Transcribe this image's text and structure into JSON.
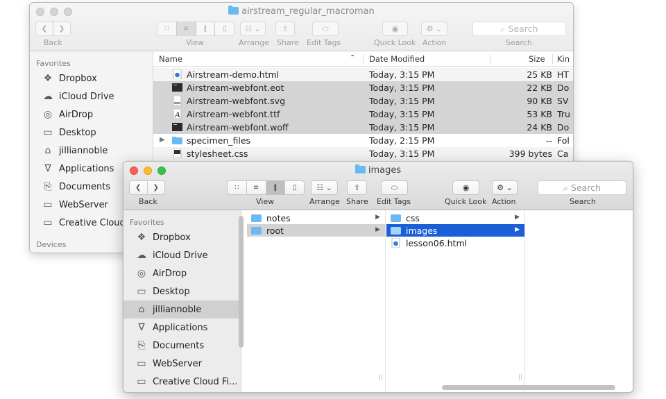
{
  "back_window": {
    "title": "airstream_regular_macroman",
    "toolbar": {
      "back_label": "Back",
      "view_label": "View",
      "arrange_label": "Arrange",
      "share_label": "Share",
      "edit_tags_label": "Edit Tags",
      "quick_look_label": "Quick Look",
      "action_label": "Action",
      "search_placeholder": "Search",
      "search_label": "Search"
    },
    "sidebar": {
      "favorites_heading": "Favorites",
      "items": [
        {
          "label": "Dropbox",
          "icon": "dropbox-icon"
        },
        {
          "label": "iCloud Drive",
          "icon": "cloud-icon"
        },
        {
          "label": "AirDrop",
          "icon": "airdrop-icon"
        },
        {
          "label": "Desktop",
          "icon": "desktop-icon"
        },
        {
          "label": "jilliannoble",
          "icon": "home-icon"
        },
        {
          "label": "Applications",
          "icon": "applications-icon"
        },
        {
          "label": "Documents",
          "icon": "documents-icon"
        },
        {
          "label": "WebServer",
          "icon": "folder-icon"
        },
        {
          "label": "Creative Cloud",
          "icon": "folder-icon"
        }
      ],
      "devices_heading": "Devices"
    },
    "columns": {
      "name": "Name",
      "date_modified": "Date Modified",
      "size": "Size",
      "kind": "Kin"
    },
    "files": [
      {
        "name": "Airstream-demo.html",
        "date": "Today, 3:15 PM",
        "size": "25 KB",
        "kind": "HT",
        "icon": "html-file-icon"
      },
      {
        "name": "Airstream-webfont.eot",
        "date": "Today, 3:15 PM",
        "size": "22 KB",
        "kind": "Do",
        "icon": "eot-file-icon"
      },
      {
        "name": "Airstream-webfont.svg",
        "date": "Today, 3:15 PM",
        "size": "90 KB",
        "kind": "SV",
        "icon": "svg-file-icon"
      },
      {
        "name": "Airstream-webfont.ttf",
        "date": "Today, 3:15 PM",
        "size": "53 KB",
        "kind": "Tru",
        "icon": "font-file-icon"
      },
      {
        "name": "Airstream-webfont.woff",
        "date": "Today, 3:15 PM",
        "size": "24 KB",
        "kind": "Do",
        "icon": "woff-file-icon"
      },
      {
        "name": "specimen_files",
        "date": "Today, 2:15 PM",
        "size": "--",
        "kind": "Fol",
        "icon": "folder-icon"
      },
      {
        "name": "stylesheet.css",
        "date": "Today, 3:15 PM",
        "size": "399 bytes",
        "kind": "Ca",
        "icon": "css-file-icon"
      }
    ]
  },
  "front_window": {
    "title": "images",
    "toolbar": {
      "back_label": "Back",
      "view_label": "View",
      "arrange_label": "Arrange",
      "share_label": "Share",
      "edit_tags_label": "Edit Tags",
      "quick_look_label": "Quick Look",
      "action_label": "Action",
      "search_placeholder": "Search",
      "search_label": "Search"
    },
    "sidebar": {
      "favorites_heading": "Favorites",
      "items": [
        {
          "label": "Dropbox",
          "icon": "dropbox-icon"
        },
        {
          "label": "iCloud Drive",
          "icon": "cloud-icon"
        },
        {
          "label": "AirDrop",
          "icon": "airdrop-icon"
        },
        {
          "label": "Desktop",
          "icon": "desktop-icon"
        },
        {
          "label": "jilliannoble",
          "icon": "home-icon",
          "selected": true
        },
        {
          "label": "Applications",
          "icon": "applications-icon"
        },
        {
          "label": "Documents",
          "icon": "documents-icon"
        },
        {
          "label": "WebServer",
          "icon": "folder-icon"
        },
        {
          "label": "Creative Cloud Fi...",
          "icon": "folder-icon"
        }
      ]
    },
    "column1": [
      {
        "name": "notes",
        "type": "folder"
      },
      {
        "name": "root",
        "type": "folder",
        "selected": true
      }
    ],
    "column2": [
      {
        "name": "css",
        "type": "folder"
      },
      {
        "name": "images",
        "type": "folder",
        "selected": true
      },
      {
        "name": "lesson06.html",
        "type": "html"
      }
    ]
  },
  "colors": {
    "selection_blue": "#1a5fd6",
    "folder_blue": "#6bb8f2"
  }
}
